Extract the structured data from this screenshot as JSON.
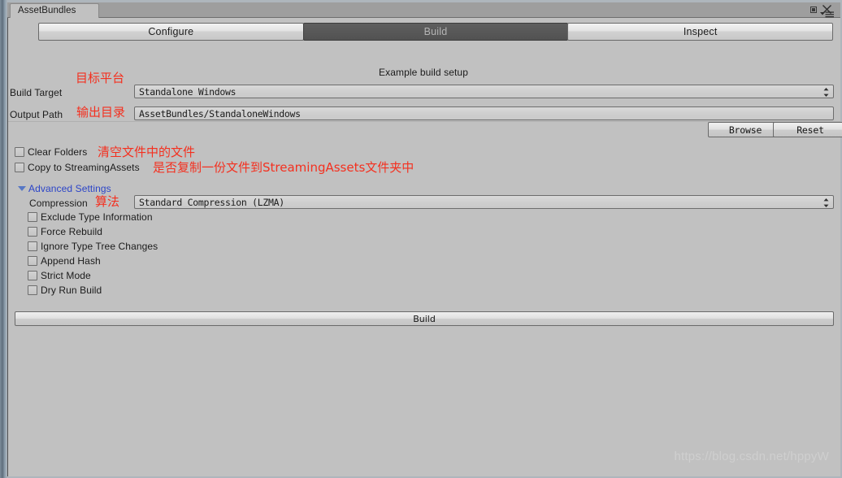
{
  "window": {
    "dock_tab_label": "AssetBundles",
    "controls": {
      "maximize": "maximize-icon",
      "close": "close-icon",
      "menu": "window-menu-icon"
    }
  },
  "tabs": [
    {
      "label": "Configure",
      "selected": false
    },
    {
      "label": "Build",
      "selected": true
    },
    {
      "label": "Inspect",
      "selected": false
    }
  ],
  "main": {
    "heading": "Example build setup",
    "build_target": {
      "label": "Build Target",
      "value": "Standalone Windows",
      "annotation": "目标平台"
    },
    "output_path": {
      "label": "Output Path",
      "value": "AssetBundles/StandaloneWindows",
      "annotation": "输出目录"
    },
    "browse_button": "Browse",
    "reset_button": "Reset",
    "clear_folders": {
      "label": "Clear Folders",
      "checked": false,
      "annotation": "清空文件中的文件"
    },
    "copy_to_streaming_assets": {
      "label": "Copy to StreamingAssets",
      "checked": false,
      "annotation": "是否复制一份文件到StreamingAssets文件夹中"
    },
    "advanced_settings": {
      "label": "Advanced Settings",
      "expanded": true,
      "compression": {
        "label": "Compression",
        "value": "Standard Compression (LZMA)",
        "annotation": "算法"
      },
      "options": [
        {
          "label": "Exclude Type Information",
          "checked": false
        },
        {
          "label": "Force Rebuild",
          "checked": false
        },
        {
          "label": "Ignore Type Tree Changes",
          "checked": false
        },
        {
          "label": "Append Hash",
          "checked": false
        },
        {
          "label": "Strict Mode",
          "checked": false
        },
        {
          "label": "Dry Run Build",
          "checked": false
        }
      ]
    },
    "build_button": "Build"
  },
  "watermark": "https://blog.csdn.net/hppyW",
  "colors": {
    "panel_bg": "#c1c1c1",
    "tab_selected_bg": "#585858",
    "foldout_blue": "#2b44c8",
    "annotation_red": "#f4301f",
    "field_bg": "#cfcfcf"
  }
}
